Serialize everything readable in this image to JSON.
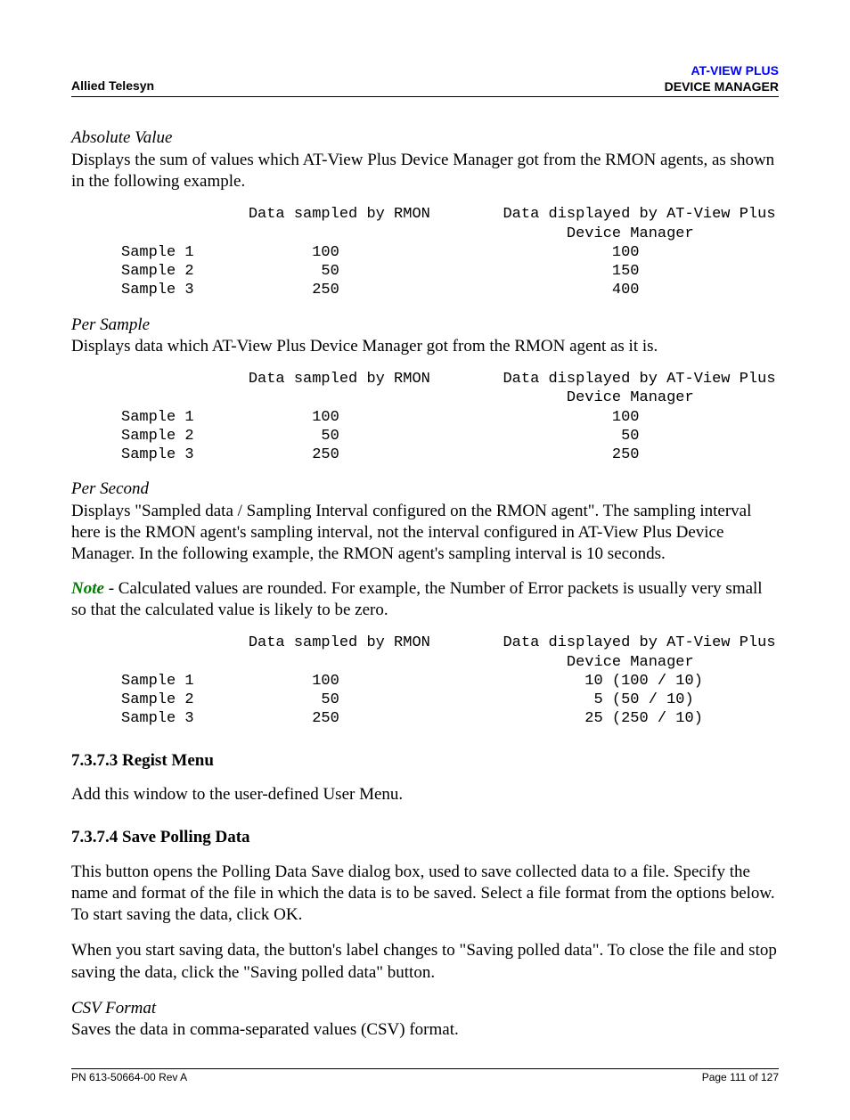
{
  "header": {
    "left": "Allied Telesyn",
    "right_line1": "AT-VIEW PLUS",
    "right_line2": "DEVICE MANAGER"
  },
  "sections": {
    "absolute_value": {
      "label": "Absolute Value",
      "text": "Displays the sum of values which AT-View Plus Device Manager got from the RMON agents, as shown in the following example.",
      "table": "              Data sampled by RMON        Data displayed by AT-View Plus\n                                                 Device Manager\nSample 1             100                              100\nSample 2              50                              150\nSample 3             250                              400"
    },
    "per_sample": {
      "label": "Per Sample",
      "text": "Displays data which AT-View Plus Device Manager got from the RMON agent as it is.",
      "table": "              Data sampled by RMON        Data displayed by AT-View Plus\n                                                 Device Manager\nSample 1             100                              100\nSample 2              50                               50\nSample 3             250                              250"
    },
    "per_second": {
      "label": "Per Second",
      "text": "Displays \"Sampled data / Sampling Interval configured on the RMON agent\". The sampling interval here is the RMON agent's sampling interval, not the interval configured in AT-View Plus Device Manager. In the following example, the RMON agent's sampling interval is 10 seconds.",
      "note_label": "Note",
      "note_text": " - Calculated values are rounded. For example, the Number of Error packets is usually very small so that the calculated value is likely to be zero.",
      "table": "              Data sampled by RMON        Data displayed by AT-View Plus\n                                                 Device Manager\nSample 1             100                           10 (100 / 10)\nSample 2              50                            5 (50 / 10)\nSample 3             250                           25 (250 / 10)"
    },
    "regist_menu": {
      "heading": "7.3.7.3 Regist Menu",
      "text": "Add this window to the user-defined User Menu."
    },
    "save_polling": {
      "heading": "7.3.7.4 Save Polling Data",
      "p1": "This button opens the Polling Data Save dialog box, used to save collected data to a file. Specify the name and format of the file in which the data is to be saved. Select a file format from the options below. To start saving the data, click OK.",
      "p2": "When you start saving data, the button's label changes to \"Saving polled data\". To close the file and stop saving the data, click the \"Saving polled data\" button."
    },
    "csv_format": {
      "label": "CSV Format",
      "text": "Saves the data in comma-separated values (CSV) format."
    }
  },
  "footer": {
    "left": "PN 613-50664-00 Rev A",
    "right": "Page 111 of 127"
  }
}
